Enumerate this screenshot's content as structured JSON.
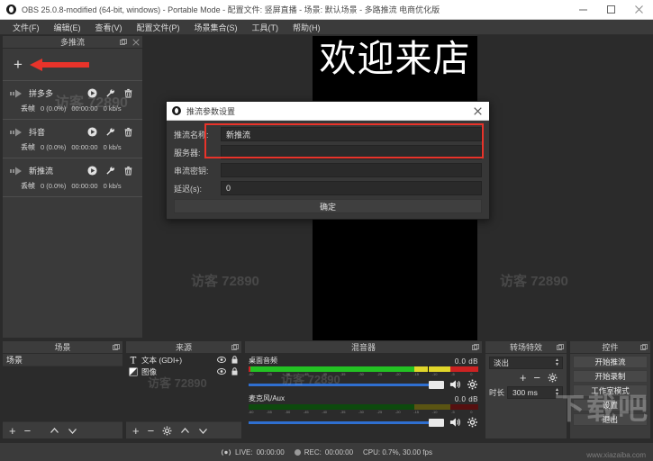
{
  "window": {
    "title": "OBS 25.0.8-modified (64-bit, windows) - Portable Mode - 配置文件: 竖屏直播 - 场景: 默认场景 - 多路推流 电商优化版",
    "minimize_icon": "minimize-icon",
    "maximize_icon": "maximize-icon",
    "close_icon": "close-icon"
  },
  "menubar": {
    "items": [
      {
        "label": "文件(F)"
      },
      {
        "label": "编辑(E)"
      },
      {
        "label": "查看(V)"
      },
      {
        "label": "配置文件(P)"
      },
      {
        "label": "场景集合(S)"
      },
      {
        "label": "工具(T)"
      },
      {
        "label": "帮助(H)"
      }
    ]
  },
  "multistream": {
    "title": "多推流",
    "add_label": "+",
    "items": [
      {
        "name": "拼多多",
        "stats_label": "丢帧",
        "dropped": "0 (0.0%)",
        "time": "00:00:00",
        "bitrate": "0 kb/s"
      },
      {
        "name": "抖音",
        "stats_label": "丢帧",
        "dropped": "0 (0.0%)",
        "time": "00:00:00",
        "bitrate": "0 kb/s"
      },
      {
        "name": "新推流",
        "stats_label": "丢帧",
        "dropped": "0 (0.0%)",
        "time": "00:00:00",
        "bitrate": "0 kb/s"
      }
    ]
  },
  "preview": {
    "canvas_text": "欢迎来店"
  },
  "dialog": {
    "title": "推流参数设置",
    "close_label": "✕",
    "fields": [
      {
        "label": "推流名称:",
        "value": "新推流"
      },
      {
        "label": "服务器:",
        "value": ""
      },
      {
        "label": "串流密钥:",
        "value": ""
      },
      {
        "label": "延迟(s):",
        "value": "0"
      }
    ],
    "ok_label": "确定",
    "highlight_color": "#e8332a"
  },
  "scenes": {
    "title": "场景",
    "items": [
      {
        "label": "场景"
      }
    ],
    "toolbar": {
      "add": "+",
      "remove": "−",
      "up": "⌃",
      "down": "⌄"
    }
  },
  "sources": {
    "title": "来源",
    "items": [
      {
        "label": "文本 (GDI+)",
        "icon": "text-source-icon"
      },
      {
        "label": "图像",
        "icon": "image-source-icon"
      }
    ],
    "toolbar": {
      "add": "+",
      "remove": "−",
      "settings": "gear-icon",
      "up": "⌃",
      "down": "⌄"
    }
  },
  "mixer": {
    "title": "混音器",
    "tracks": [
      {
        "name": "桌面音频",
        "db": "0.0 dB",
        "active": true,
        "level_pct": 72
      },
      {
        "name": "麦克风/Aux",
        "db": "0.0 dB",
        "active": false,
        "level_pct": 0
      }
    ],
    "ticks": [
      "-60",
      "-55",
      "-50",
      "-45",
      "-40",
      "-35",
      "-30",
      "-25",
      "-20",
      "-15",
      "-10",
      "-5",
      "0"
    ]
  },
  "transitions": {
    "title": "转场特效",
    "selected": "淡出",
    "add": "+",
    "remove": "−",
    "settings": "gear-icon",
    "duration_label": "时长",
    "duration_value": "300 ms"
  },
  "controls": {
    "title": "控件",
    "buttons": [
      {
        "label": "开始推流"
      },
      {
        "label": "开始录制"
      },
      {
        "label": "工作室模式"
      },
      {
        "label": "设置"
      },
      {
        "label": "退出"
      }
    ]
  },
  "statusbar": {
    "live_label": "LIVE:",
    "live_time": "00:00:00",
    "rec_label": "REC:",
    "rec_time": "00:00:00",
    "cpu": "CPU: 0.7%, 30.00 fps"
  },
  "watermarks": {
    "visitor": "访客 72890",
    "brand": "下载吧",
    "url": "www.xiazaiba.com"
  }
}
